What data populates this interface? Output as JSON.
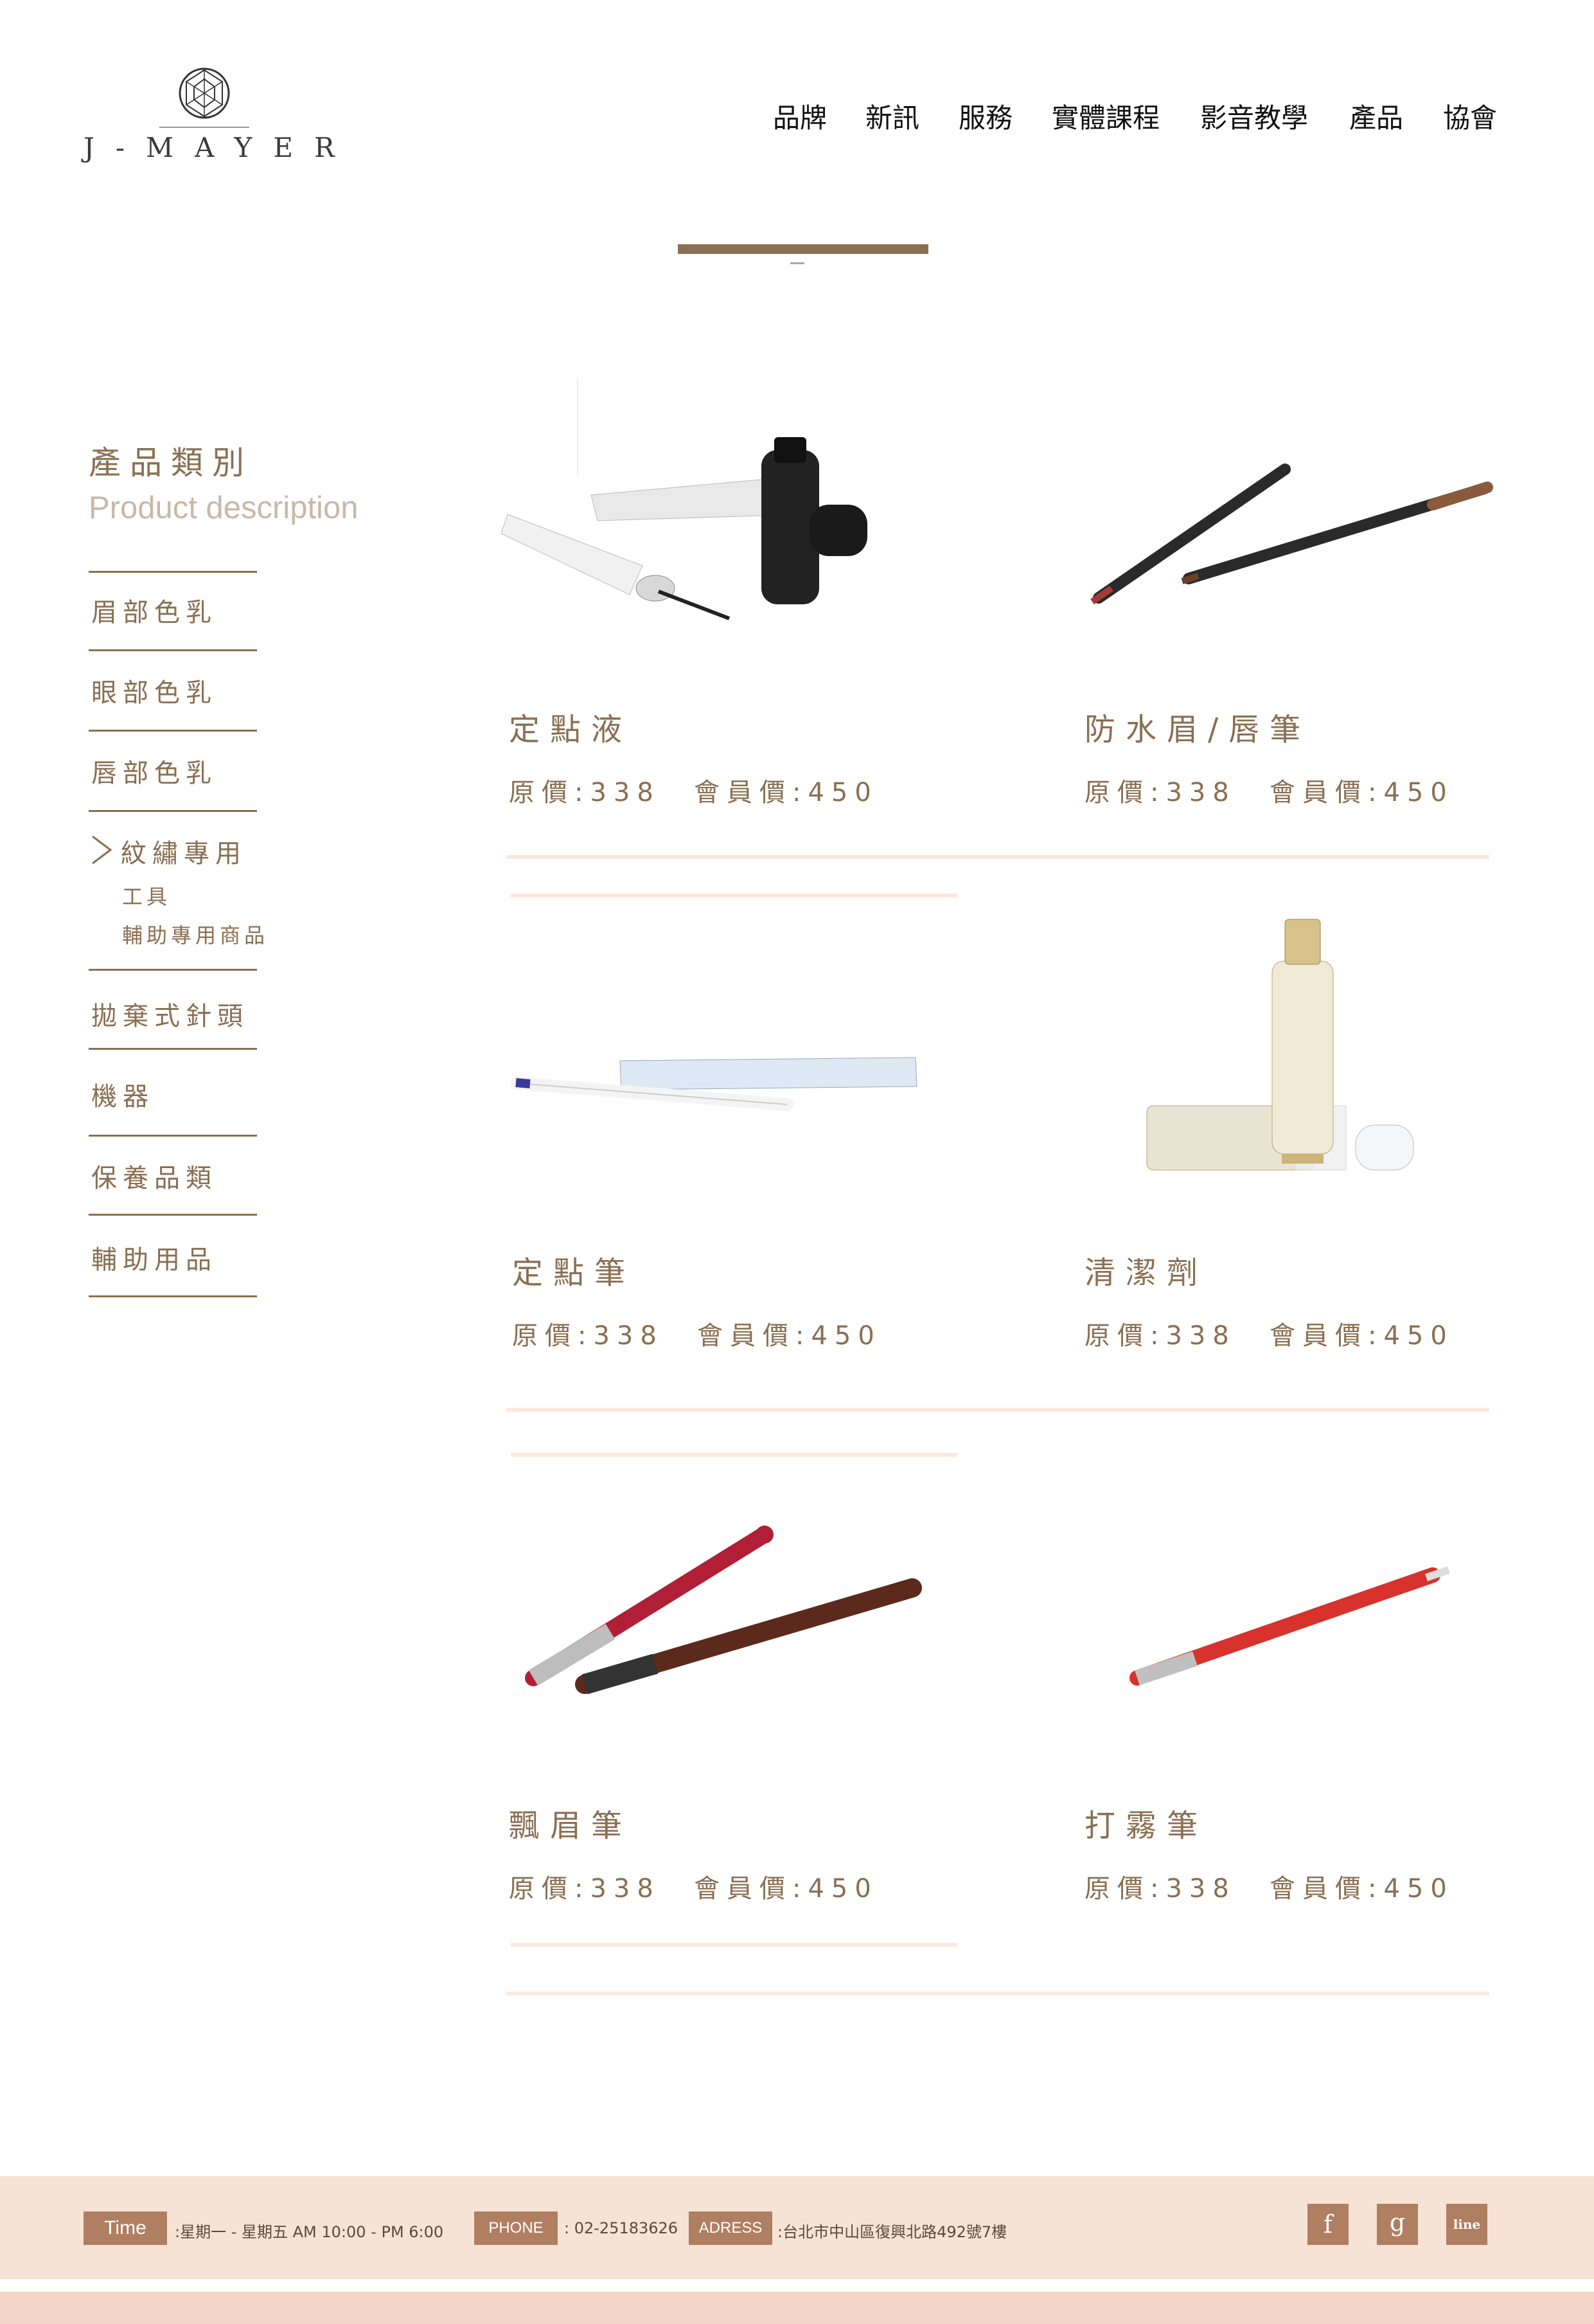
{
  "brand": {
    "logo_text": "J-MAYER"
  },
  "nav": [
    "品牌",
    "新訊",
    "服務",
    "實體課程",
    "影音教學",
    "產品",
    "協會"
  ],
  "sidebar": {
    "title": "產品類別",
    "subtitle": "Product  description",
    "items": [
      "眉部色乳",
      "眼部色乳",
      "唇部色乳",
      "紋繡專用",
      "拋棄式針頭",
      "機器",
      "保養品類",
      "輔助用品"
    ],
    "subitems": [
      "工具",
      "輔助專用商品"
    ]
  },
  "products": [
    {
      "name": "定點液",
      "price": "原價:338",
      "member_price": "會員價:450"
    },
    {
      "name": "防水眉/唇筆",
      "price": "原價:338",
      "member_price": "會員價:450"
    },
    {
      "name": "定點筆",
      "price": "原價:338",
      "member_price": "會員價:450"
    },
    {
      "name": "清潔劑",
      "price": "原價:338",
      "member_price": "會員價:450"
    },
    {
      "name": "飄眉筆",
      "price": "原價:338",
      "member_price": "會員價:450"
    },
    {
      "name": "打霧筆",
      "price": "原價:338",
      "member_price": "會員價:450"
    }
  ],
  "footer": {
    "time_label": "Time",
    "time_value": ":星期一 - 星期五 AM 10:00 - PM 6:00",
    "phone_label": "PHONE",
    "phone_value": ": 02-25183626",
    "address_label": "ADRESS",
    "address_value": ":台北市中山區復興北路492號7樓",
    "social": [
      "f",
      "g",
      "line"
    ]
  },
  "colors": {
    "accent": "#8a6f52",
    "footer_bg": "#f7e3d6",
    "tag": "#b07e61"
  }
}
